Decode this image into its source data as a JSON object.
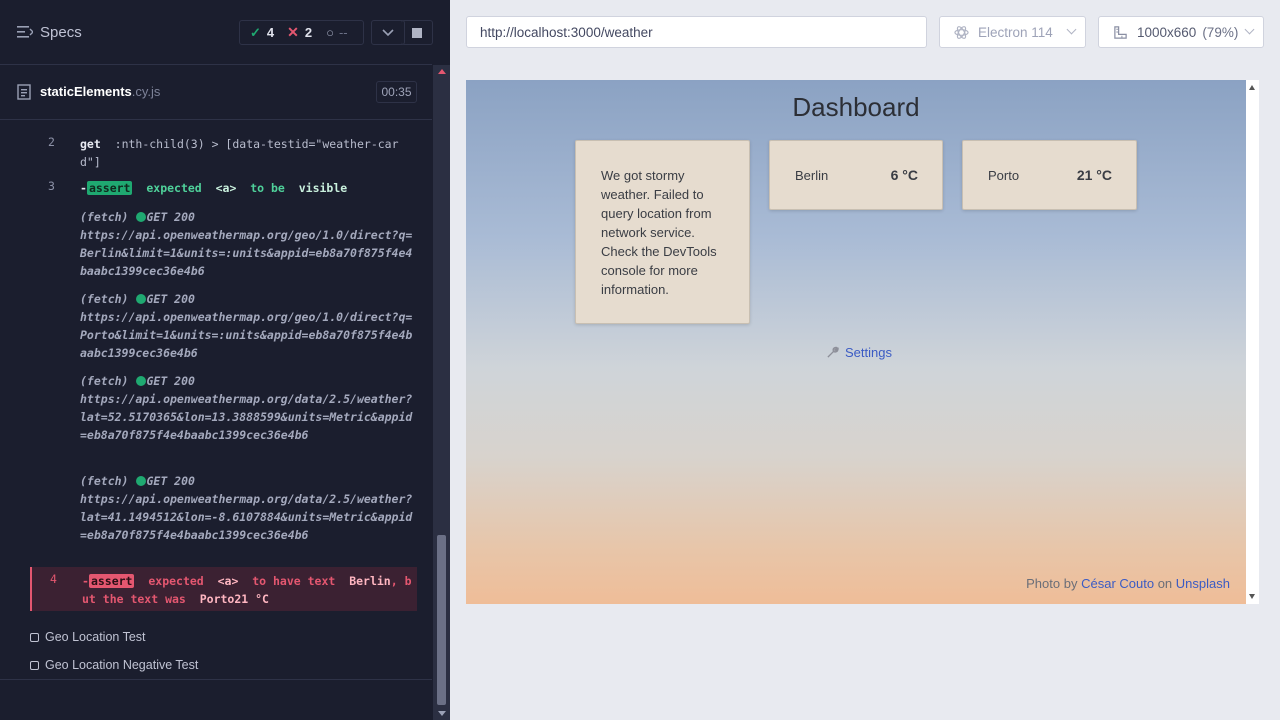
{
  "sidebar": {
    "specs_label": "Specs",
    "stats": {
      "passed": "4",
      "failed": "2",
      "pending": "--"
    },
    "spec_file": {
      "name": "staticElements",
      "ext": ".cy.js",
      "time": "00:35"
    }
  },
  "commands": {
    "c2": {
      "num": "2",
      "name": "get",
      "selector": ":nth-child(3) > [data-testid=\"weather-card\"]"
    },
    "c3": {
      "num": "3",
      "dash": "-",
      "tag": "assert",
      "msg1": "expected",
      "val1": "<a>",
      "msg2": "to be",
      "val2": "visible"
    },
    "fetches": [
      {
        "label": "(fetch)",
        "status": "GET 200",
        "url": "https://api.openweathermap.org/geo/1.0/direct?q=Berlin&limit=1&units=:units&appid=eb8a70f875f4e4baabc1399cec36e4b6"
      },
      {
        "label": "(fetch)",
        "status": "GET 200",
        "url": "https://api.openweathermap.org/geo/1.0/direct?q=Porto&limit=1&units=:units&appid=eb8a70f875f4e4baabc1399cec36e4b6"
      },
      {
        "label": "(fetch)",
        "status": "GET 200",
        "url": "https://api.openweathermap.org/data/2.5/weather?lat=52.5170365&lon=13.3888599&units=Metric&appid=eb8a70f875f4e4baabc1399cec36e4b6"
      },
      {
        "label": "(fetch)",
        "status": "GET 200",
        "url": "https://api.openweathermap.org/data/2.5/weather?lat=41.1494512&lon=-8.6107884&units=Metric&appid=eb8a70f875f4e4baabc1399cec36e4b6"
      }
    ],
    "c4": {
      "num": "4",
      "dash": "-",
      "tag": "assert",
      "msg1": "expected",
      "val1": "<a>",
      "msg2": "to have text",
      "val2": "Berlin",
      "msg3": ", but the text was",
      "val3": "Porto21 °C"
    }
  },
  "tests": [
    {
      "label": "Geo Location Test"
    },
    {
      "label": "Geo Location Negative Test"
    }
  ],
  "toolbar": {
    "url": "http://localhost:3000/weather",
    "browser": "Electron 114",
    "viewport": "1000x660",
    "zoom": "(79%)"
  },
  "app": {
    "title": "Dashboard",
    "error_card": "We got stormy weather. Failed to query location from network service. Check the DevTools console for more information.",
    "cards": [
      {
        "city": "Berlin",
        "temp": "6 °C"
      },
      {
        "city": "Porto",
        "temp": "21 °C"
      }
    ],
    "settings_label": "Settings",
    "credit": {
      "prefix": "Photo by",
      "author": "César Couto",
      "on": "on",
      "site": "Unsplash"
    }
  },
  "colors": {
    "pass": "#1fa971",
    "fail": "#e45770",
    "link": "#3b5bc4",
    "runner_bg": "#1b1e2e"
  }
}
